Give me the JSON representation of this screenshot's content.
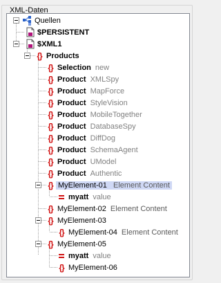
{
  "group_title": "XML-Daten",
  "root": {
    "label": "Quellen",
    "icon": "database-icon"
  },
  "sources": [
    {
      "label": "$PERSISTENT",
      "icon": "document-icon"
    },
    {
      "label": "$XML1",
      "icon": "document-icon"
    }
  ],
  "products_label": "Products",
  "selection": {
    "label": "Selection",
    "value": "new"
  },
  "products": [
    {
      "label": "Product",
      "value": "XMLSpy"
    },
    {
      "label": "Product",
      "value": "MapForce"
    },
    {
      "label": "Product",
      "value": "StyleVision"
    },
    {
      "label": "Product",
      "value": "MobileTogether"
    },
    {
      "label": "Product",
      "value": "DatabaseSpy"
    },
    {
      "label": "Product",
      "value": "DiffDog"
    },
    {
      "label": "Product",
      "value": "SchemaAgent"
    },
    {
      "label": "Product",
      "value": "UModel"
    },
    {
      "label": "Product",
      "value": "Authentic"
    }
  ],
  "my1": {
    "label": "MyElement-01",
    "value": "Element Content",
    "highlight_color": "#cfd8f5"
  },
  "my1_att": {
    "label": "myatt",
    "value": "value"
  },
  "my2": {
    "label": "MyElement-02",
    "value": "Element Content"
  },
  "my3": {
    "label": "MyElement-03"
  },
  "my4": {
    "label": "MyElement-04",
    "value": "Element Content"
  },
  "my5": {
    "label": "MyElement-05"
  },
  "my5_att": {
    "label": "myatt",
    "value": "value"
  },
  "my6": {
    "label": "MyElement-06"
  },
  "colors": {
    "element_icon": "#d01010",
    "value_text": "#808080",
    "tree_line": "#a0a0a0"
  }
}
